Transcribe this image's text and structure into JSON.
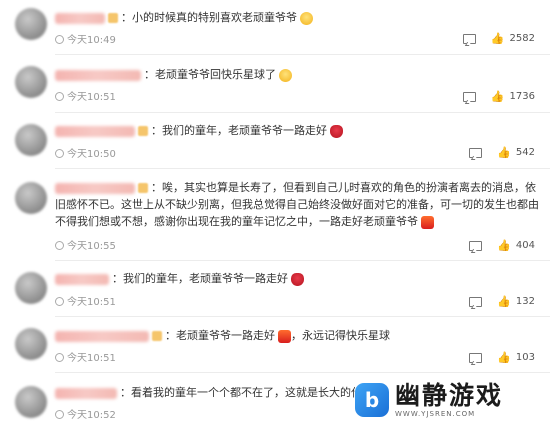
{
  "comments": [
    {
      "text": "小的时候真的特别喜欢老顽童爷爷",
      "emoji": "face-emoji",
      "time": "今天10:49",
      "likes": "2582"
    },
    {
      "text": "老顽童爷爷回快乐星球了",
      "emoji": "face-emoji",
      "time": "今天10:51",
      "likes": "1736"
    },
    {
      "text": "我们的童年，老顽童爷爷一路走好",
      "emoji": "rose-emoji",
      "time": "今天10:50",
      "likes": "542"
    },
    {
      "text": "唉，其实也算是长寿了，但看到自己儿时喜欢的角色的扮演者离去的消息，依旧感怀不已。这世上从不缺少别离，但我总觉得自己始终没做好面对它的准备，可一切的发生也都由不得我们想或不想，感谢你出现在我的童年记忆之中，一路走好老顽童爷爷",
      "emoji": "candle-emoji",
      "time": "今天10:55",
      "likes": "404"
    },
    {
      "text": "我们的童年，老顽童爷爷一路走好",
      "emoji": "rose-emoji",
      "time": "今天10:51",
      "likes": "132"
    },
    {
      "text": "老顽童爷爷一路走好",
      "text2": "，永远记得快乐星球",
      "emoji": "candle-emoji",
      "time": "今天10:51",
      "likes": "103"
    },
    {
      "text": "看着我的童年一个个都不在了，这就是长大的代价",
      "time": "今天10:52",
      "likes": ""
    }
  ],
  "watermark": {
    "title": "幽静游戏",
    "url": "WWW.YJSREN.COM",
    "logo_letter": "b"
  },
  "colors": {
    "text": "#333333",
    "time": "#999999",
    "accent": "#1a6fd6"
  }
}
